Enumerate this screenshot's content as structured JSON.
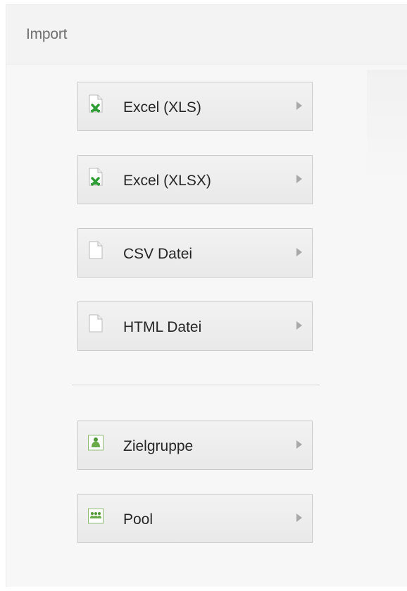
{
  "panel": {
    "title": "Import"
  },
  "items": [
    {
      "label": "Excel (XLS)",
      "icon": "excel-file-icon"
    },
    {
      "label": "Excel (XLSX)",
      "icon": "excel-file-icon"
    },
    {
      "label": "CSV Datei",
      "icon": "blank-file-icon"
    },
    {
      "label": "HTML Datei",
      "icon": "blank-file-icon"
    },
    {
      "label": "Zielgruppe",
      "icon": "target-group-icon"
    },
    {
      "label": "Pool",
      "icon": "pool-icon"
    }
  ],
  "colors": {
    "excel_green": "#2f9d35",
    "item_bg": "#ececec",
    "arrow_gray": "#a8a8a8"
  }
}
